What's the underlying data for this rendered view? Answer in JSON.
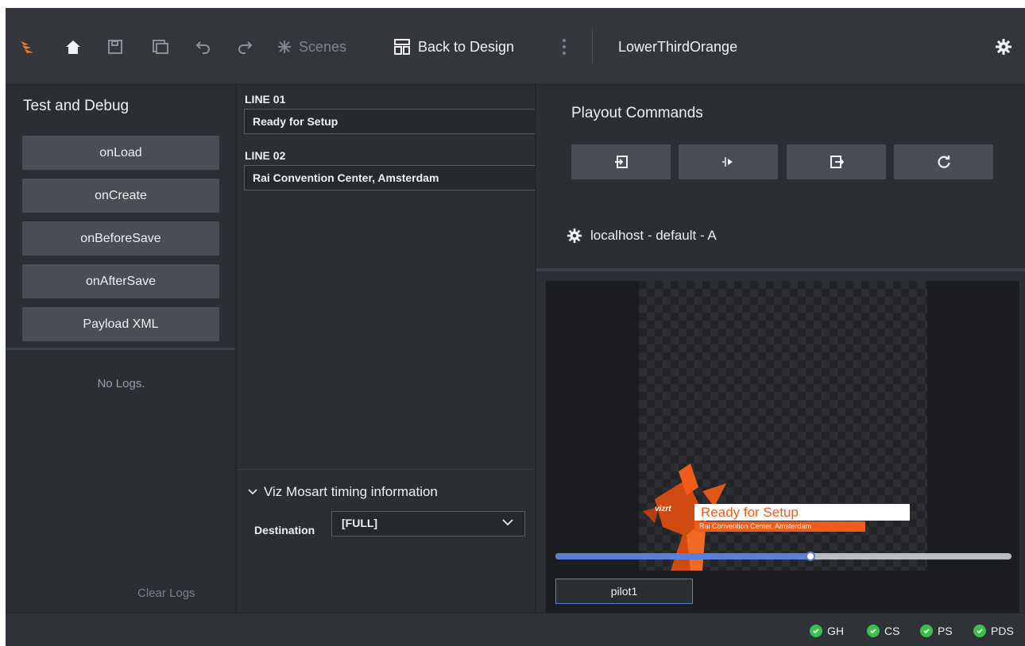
{
  "toolbar": {
    "scenes_label": "Scenes",
    "back_to_design_label": "Back to Design",
    "template_name": "LowerThirdOrange"
  },
  "test_debug": {
    "title": "Test and Debug",
    "buttons": [
      "onLoad",
      "onCreate",
      "onBeforeSave",
      "onAfterSave",
      "Payload XML"
    ],
    "no_logs": "No Logs.",
    "clear_logs": "Clear Logs"
  },
  "fields": {
    "line01_label": "LINE 01",
    "line01_value": "Ready for Setup",
    "line02_label": "LINE 02",
    "line02_value": "Rai Convention Center,  Amsterdam"
  },
  "timing": {
    "section_title": "Viz Mosart timing information",
    "destination_label": "Destination",
    "destination_value": "[FULL]"
  },
  "playout": {
    "title": "Playout Commands",
    "commands": [
      "take-in-icon",
      "continue-icon",
      "take-out-icon",
      "update-icon"
    ],
    "host": "localhost - default - A"
  },
  "preview": {
    "logo_text": "vizrt",
    "title_text": "Ready for Setup",
    "subtitle_text": "Rai Convention Center,  Amsterdam",
    "scrub_progress": 0.56,
    "pilot_label": "pilot1"
  },
  "statusbar": {
    "items": [
      "GH",
      "CS",
      "PS",
      "PDS"
    ],
    "ok_color": "#3bbf4e"
  },
  "colors": {
    "accent_orange": "#f05a1a",
    "scrub_blue": "#5b7fd6"
  }
}
